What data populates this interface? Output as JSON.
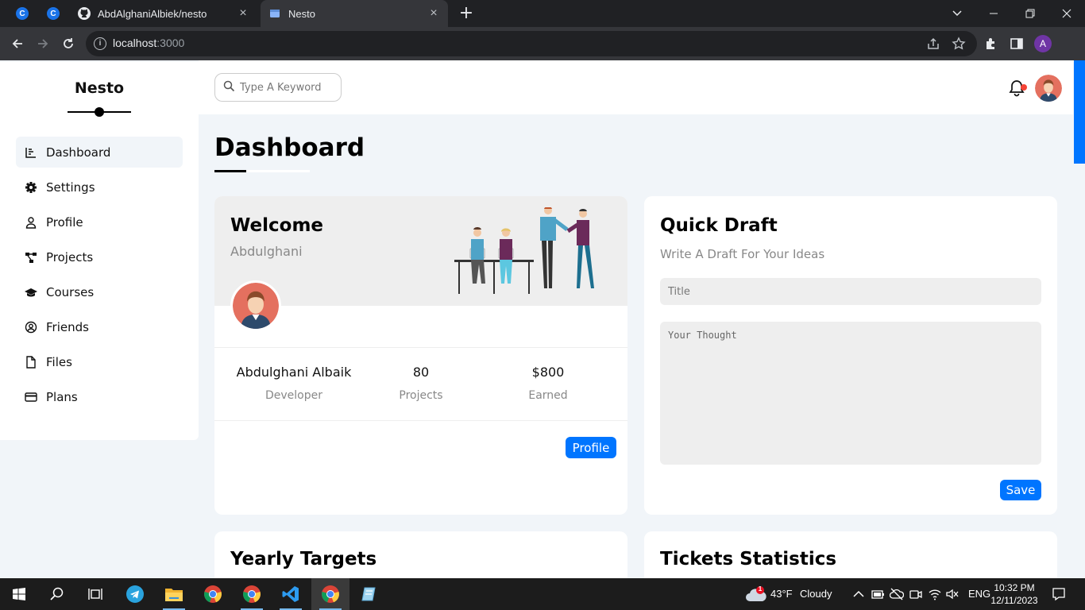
{
  "browser": {
    "tabs": [
      {
        "title": "AbdAlghaniAlbiek/nesto",
        "close": "×"
      },
      {
        "title": "Nesto",
        "close": "×"
      }
    ],
    "pinned_tabs": [
      "C",
      "C"
    ],
    "new_tab": "+",
    "url_host": "localhost",
    "url_port": ":3000",
    "profile_initial": "A",
    "info_glyph": "i"
  },
  "sidebar": {
    "brand": "Nesto",
    "items": [
      {
        "label": "Dashboard",
        "icon": "chart-icon"
      },
      {
        "label": "Settings",
        "icon": "gear-icon"
      },
      {
        "label": "Profile",
        "icon": "user-icon"
      },
      {
        "label": "Projects",
        "icon": "diagram-icon"
      },
      {
        "label": "Courses",
        "icon": "graduation-cap-icon"
      },
      {
        "label": "Friends",
        "icon": "circle-user-icon"
      },
      {
        "label": "Files",
        "icon": "file-icon"
      },
      {
        "label": "Plans",
        "icon": "credit-card-icon"
      }
    ],
    "active": "Dashboard"
  },
  "header": {
    "search_placeholder": "Type A Keyword"
  },
  "page": {
    "title": "Dashboard"
  },
  "welcome": {
    "title": "Welcome",
    "subtitle": "Abdulghani",
    "stats": [
      {
        "value": "Abdulghani Albaik",
        "label": "Developer"
      },
      {
        "value": "80",
        "label": "Projects"
      },
      {
        "value": "$800",
        "label": "Earned"
      }
    ],
    "button": "Profile"
  },
  "quick_draft": {
    "title": "Quick Draft",
    "subtitle": "Write A Draft For Your Ideas",
    "title_placeholder": "Title",
    "thought_placeholder": "Your Thought",
    "button": "Save"
  },
  "sections": {
    "yearly_targets": "Yearly Targets",
    "tickets_statistics": "Tickets Statistics"
  },
  "taskbar": {
    "weather_temp": "43°F",
    "weather_desc": "Cloudy",
    "weather_badge": "1",
    "language": "ENG",
    "time": "10:32 PM",
    "date": "12/11/2023"
  },
  "colors": {
    "accent": "#0075ff",
    "page_bg": "#f1f5f9",
    "notification_dot": "#f44336"
  }
}
